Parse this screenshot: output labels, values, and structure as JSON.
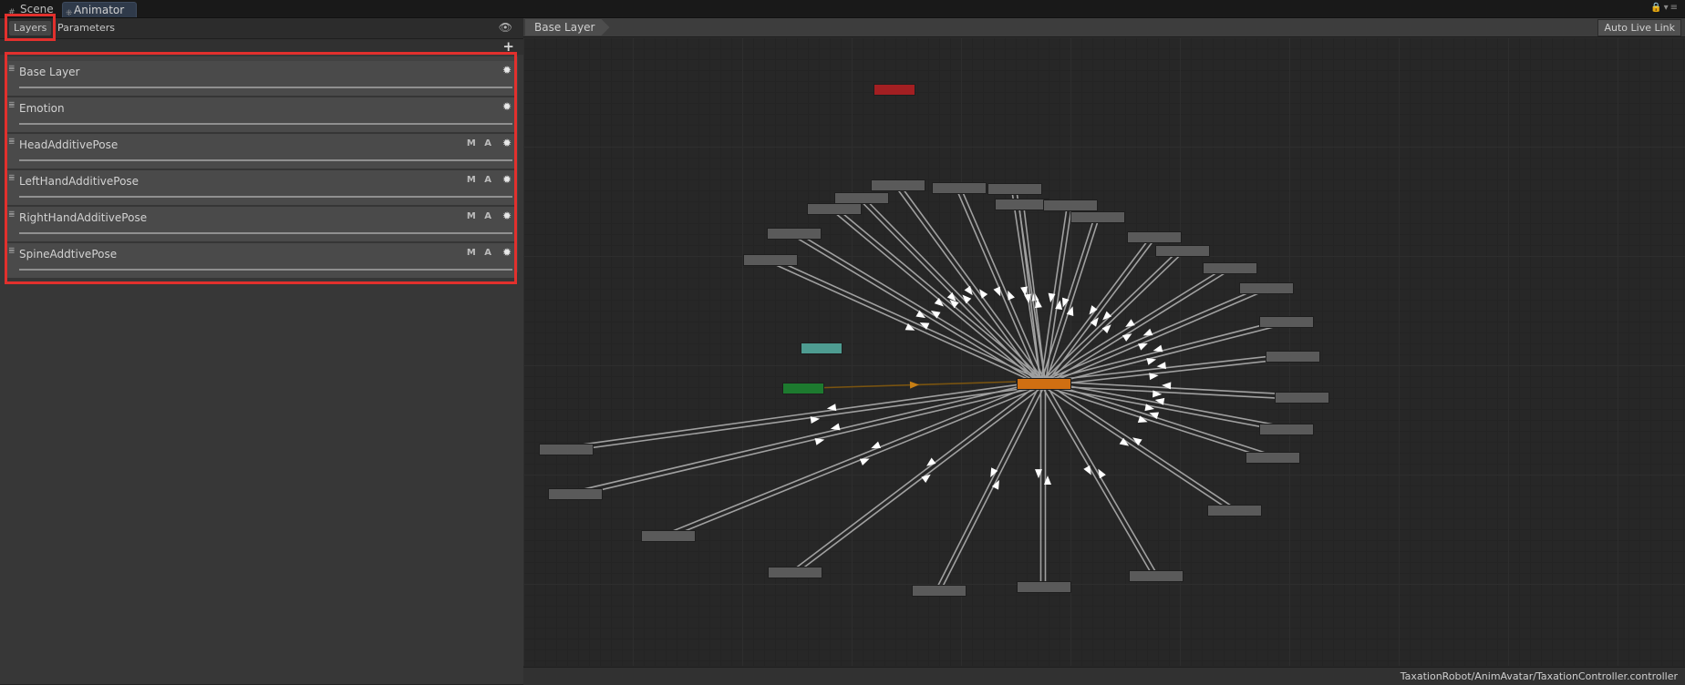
{
  "tabs": {
    "scene": "Scene",
    "animator": "Animator",
    "scene_icon": "grid-icon",
    "animator_icon": "animator-icon"
  },
  "window_controls": "lock-icon menu-icon",
  "left_panel": {
    "tab_layers": "Layers",
    "tab_parameters": "Parameters",
    "eye_icon": "eye-icon",
    "add_icon": "plus-icon",
    "layers": [
      {
        "name": "Base Layer",
        "flags": ""
      },
      {
        "name": "Emotion",
        "flags": ""
      },
      {
        "name": "HeadAdditivePose",
        "flags": "M A"
      },
      {
        "name": "LeftHandAdditivePose",
        "flags": "M A"
      },
      {
        "name": "RightHandAdditivePose",
        "flags": "M A"
      },
      {
        "name": "SpineAddtivePose",
        "flags": "M A"
      }
    ]
  },
  "graph": {
    "breadcrumb": "Base Layer",
    "auto_live_link": "Auto Live Link",
    "status_path": "TaxationRobot/AnimAvatar/TaxationController.controller",
    "colors": {
      "accent_highlight": "#e2302d",
      "entry_node": "#1d7a2f",
      "any_state_node": "#4e9c91",
      "exit_node": "#a31f22",
      "default_state": "#d06f12",
      "state_node": "#5a5a5a",
      "transition": "#a0a0a0",
      "default_transition": "#7a5410"
    }
  }
}
